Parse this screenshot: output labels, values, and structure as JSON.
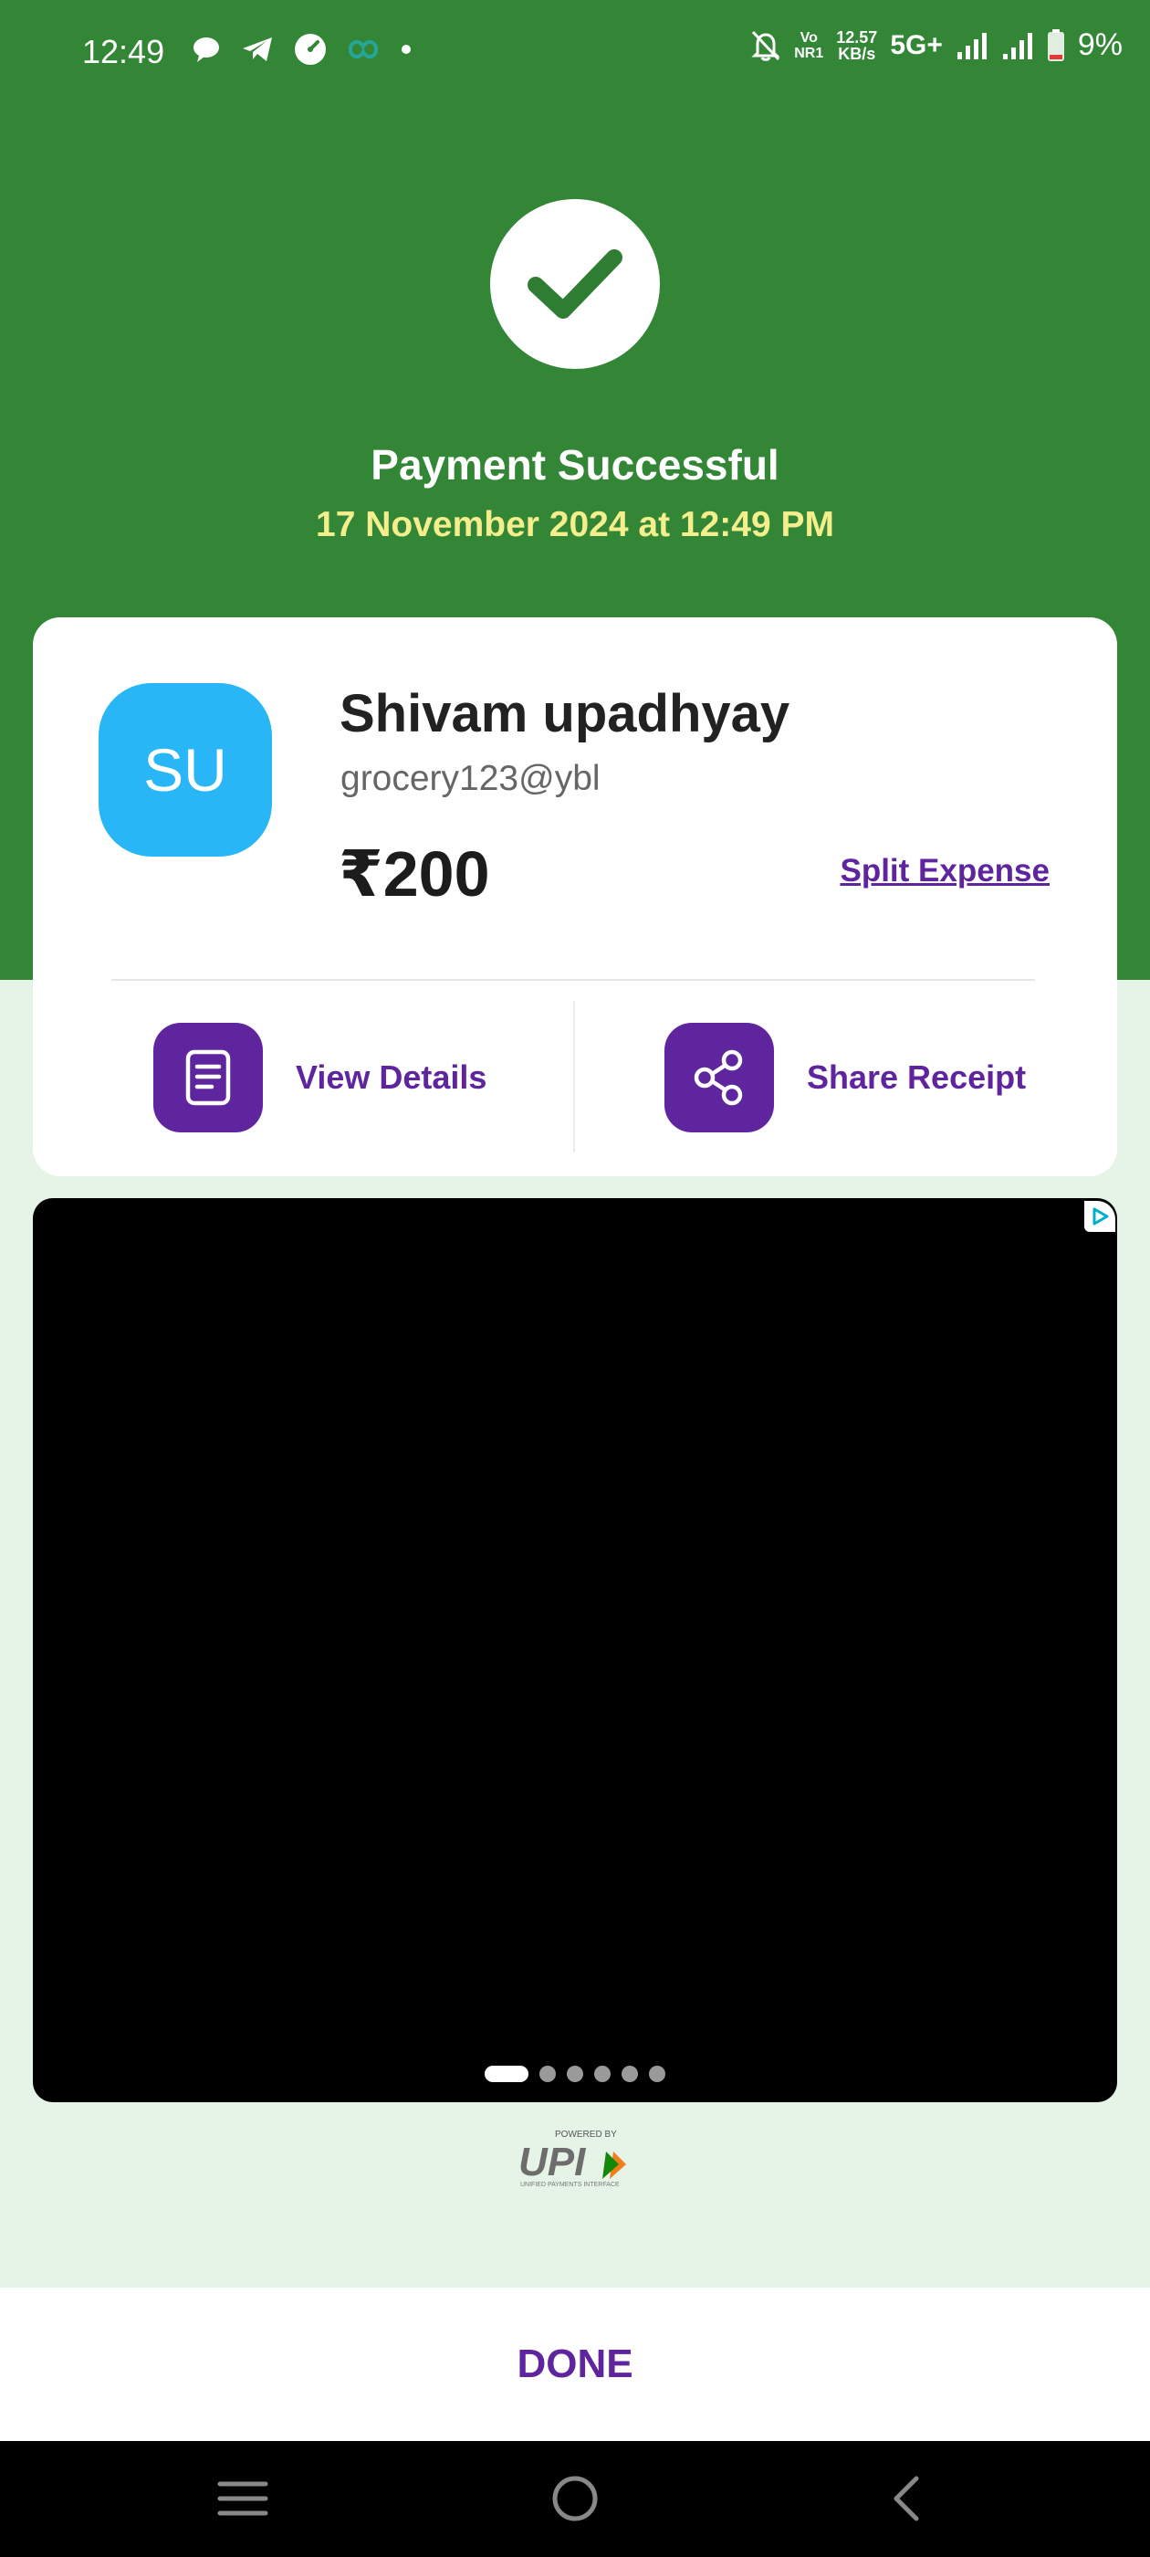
{
  "status_bar": {
    "time": "12:49",
    "network_vo": "Vo",
    "network_nr": "NR1",
    "speed_value": "12.57",
    "speed_unit": "KB/s",
    "network_type": "5G+",
    "battery": "9%"
  },
  "header": {
    "title": "Payment Successful",
    "datetime": "17 November 2024 at 12:49 PM"
  },
  "payee": {
    "initials": "SU",
    "name": "Shivam upadhyay",
    "upi_id": "grocery123@ybl",
    "amount": "₹200",
    "split_label": "Split Expense"
  },
  "actions": {
    "view_details": "View Details",
    "share_receipt": "Share Receipt"
  },
  "ad": {
    "slide_count": 6,
    "active_slide": 1
  },
  "footer": {
    "done_label": "DONE",
    "upi_powered_by": "POWERED BY",
    "upi_logo_text": "UPI",
    "upi_subtext": "UNIFIED PAYMENTS INTERFACE"
  },
  "colors": {
    "header_green": "#328636",
    "brand_purple": "#5f259f",
    "avatar_blue": "#29b6f6",
    "datetime_yellow": "#f5ee8c",
    "page_bg": "#e6f4e8"
  }
}
